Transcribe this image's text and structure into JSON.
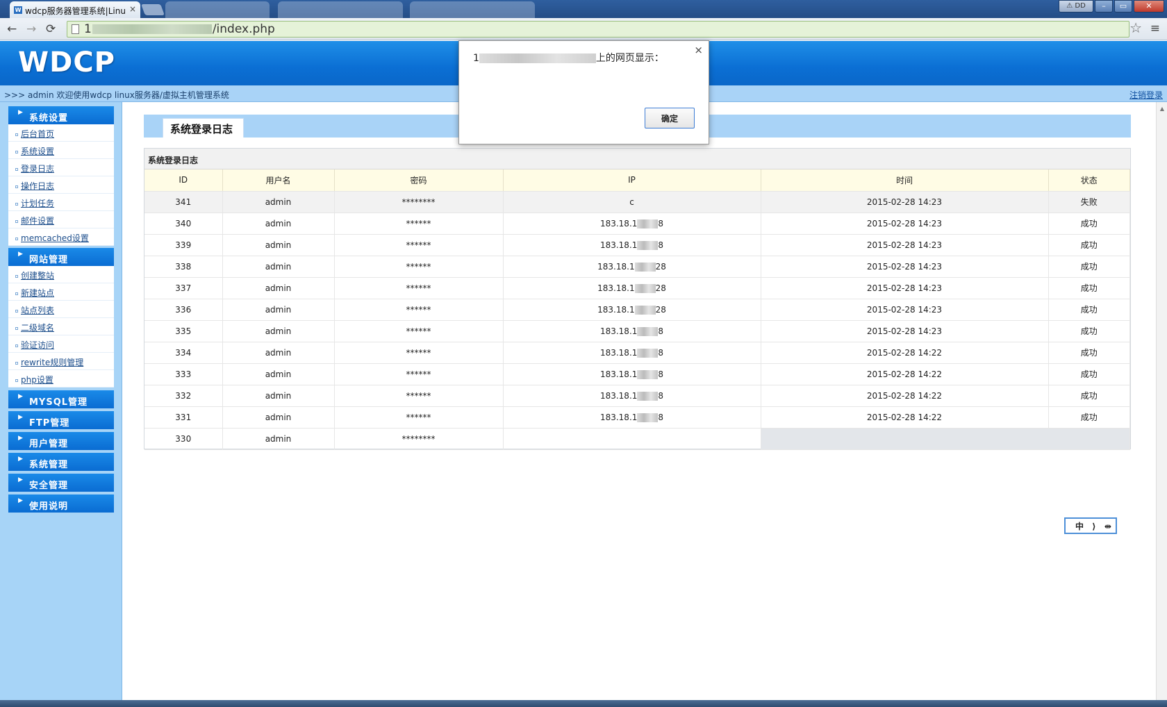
{
  "browser": {
    "active_tab_title": "wdcp服务器管理系统|Linu",
    "tab_close": "×",
    "url_host_masked": "1",
    "url_path": "/index.php",
    "profile_label": "DD",
    "back_icon": "←",
    "forward_icon": "→",
    "reload_icon": "⟳",
    "star_icon": "☆",
    "menu_icon": "≡"
  },
  "header": {
    "logo": "WDCP",
    "welcome": ">>> admin 欢迎使用wdcp linux服务器/虚拟主机管理系统",
    "logout": "注销登录"
  },
  "sidebar": {
    "groups": [
      {
        "label": "系统设置",
        "items": [
          "后台首页",
          "系统设置",
          "登录日志",
          "操作日志",
          "计划任务",
          "邮件设置",
          "memcached设置"
        ]
      },
      {
        "label": "网站管理",
        "items": [
          "创建整站",
          "新建站点",
          "站点列表",
          "二级域名",
          "验证访问",
          "rewrite规则管理",
          "php设置"
        ]
      },
      {
        "label": "MYSQL管理"
      },
      {
        "label": "FTP管理"
      },
      {
        "label": "用户管理"
      },
      {
        "label": "系统管理"
      },
      {
        "label": "安全管理"
      },
      {
        "label": "使用说明"
      }
    ]
  },
  "page": {
    "tab_title": "系统登录日志",
    "panel_title": "系统登录日志",
    "columns": [
      "ID",
      "用户名",
      "密码",
      "IP",
      "时间",
      "状态"
    ],
    "rows": [
      {
        "id": "341",
        "user": "admin",
        "pwd": "********",
        "ip_a": "c",
        "ip_b": "",
        "time": "2015-02-28 14:23",
        "status": "失败"
      },
      {
        "id": "340",
        "user": "admin",
        "pwd": "******",
        "ip_a": "183.18.1",
        "ip_b": "8",
        "time": "2015-02-28 14:23",
        "status": "成功"
      },
      {
        "id": "339",
        "user": "admin",
        "pwd": "******",
        "ip_a": "183.18.1",
        "ip_b": "8",
        "time": "2015-02-28 14:23",
        "status": "成功"
      },
      {
        "id": "338",
        "user": "admin",
        "pwd": "******",
        "ip_a": "183.18.1",
        "ip_b": "28",
        "time": "2015-02-28 14:23",
        "status": "成功"
      },
      {
        "id": "337",
        "user": "admin",
        "pwd": "******",
        "ip_a": "183.18.1",
        "ip_b": "28",
        "time": "2015-02-28 14:23",
        "status": "成功"
      },
      {
        "id": "336",
        "user": "admin",
        "pwd": "******",
        "ip_a": "183.18.1",
        "ip_b": "28",
        "time": "2015-02-28 14:23",
        "status": "成功"
      },
      {
        "id": "335",
        "user": "admin",
        "pwd": "******",
        "ip_a": "183.18.1",
        "ip_b": "8",
        "time": "2015-02-28 14:23",
        "status": "成功"
      },
      {
        "id": "334",
        "user": "admin",
        "pwd": "******",
        "ip_a": "183.18.1",
        "ip_b": "8",
        "time": "2015-02-28 14:22",
        "status": "成功"
      },
      {
        "id": "333",
        "user": "admin",
        "pwd": "******",
        "ip_a": "183.18.1",
        "ip_b": "8",
        "time": "2015-02-28 14:22",
        "status": "成功"
      },
      {
        "id": "332",
        "user": "admin",
        "pwd": "******",
        "ip_a": "183.18.1",
        "ip_b": "8",
        "time": "2015-02-28 14:22",
        "status": "成功"
      },
      {
        "id": "331",
        "user": "admin",
        "pwd": "******",
        "ip_a": "183.18.1",
        "ip_b": "8",
        "time": "2015-02-28 14:22",
        "status": "成功"
      },
      {
        "id": "330",
        "user": "admin",
        "pwd": "********",
        "ip_a": "",
        "ip_b": "",
        "time": "",
        "status": ""
      }
    ]
  },
  "dialog": {
    "host_masked": "1",
    "message_suffix": "上的网页显示：",
    "ok": "确定",
    "close": "×"
  },
  "ime": {
    "label": "中 ⟩ ⇹"
  }
}
